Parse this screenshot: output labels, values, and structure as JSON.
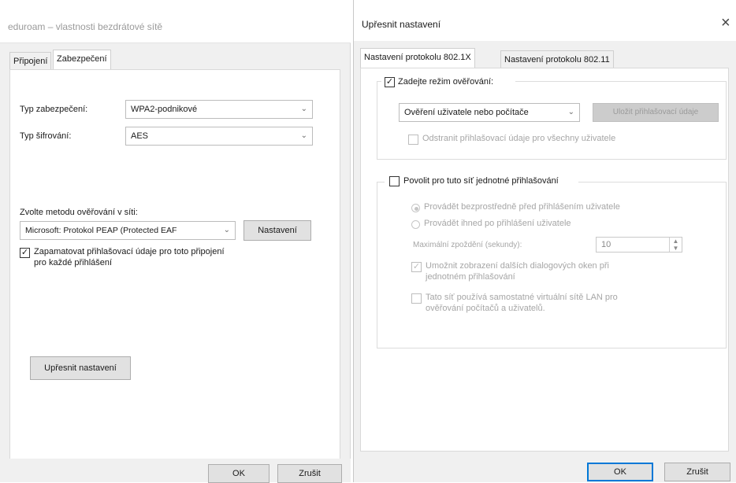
{
  "left_window": {
    "title": "eduroam – vlastnosti bezdrátové sítě",
    "tabs": [
      "Připojení",
      "Zabezpečení"
    ],
    "security_type_label": "Typ zabezpečení:",
    "security_type_value": "WPA2-podnikové",
    "encryption_type_label": "Typ šifrování:",
    "encryption_type_value": "AES",
    "auth_method_label": "Zvolte metodu ověřování v síti:",
    "auth_method_value": "Microsoft: Protokol PEAP (Protected EAF",
    "settings_button": "Nastavení",
    "remember_checkbox_line1": "Zapamatovat přihlašovací údaje pro toto připojení",
    "remember_checkbox_line2": "pro každé přihlášení",
    "remember_checked": true,
    "advanced_button": "Upřesnit nastavení",
    "ok_button": "OK",
    "cancel_button": "Zrušit"
  },
  "right_window": {
    "title": "Upřesnit nastavení",
    "close_glyph": "×",
    "tabs": [
      "Nastavení protokolu 802.1X",
      "Nastavení protokolu 802.11"
    ],
    "specify_auth_label": "Zadejte režim ověřování:",
    "specify_auth_checked": true,
    "auth_mode_value": "Ověření uživatele nebo počítače",
    "save_credentials_button": "Uložit přihlašovací údaje",
    "delete_credentials_label": "Odstranit přihlašovací údaje pro všechny uživatele",
    "sso_label": "Povolit pro tuto síť jednotné přihlašování",
    "sso_checked": false,
    "radio_before_logon": "Provádět bezprostředně před přihlášením uživatele",
    "radio_after_logon": "Provádět ihned po přihlášení uživatele",
    "max_delay_label": "Maximální zpoždění (sekundy):",
    "max_delay_value": "10",
    "allow_dialogs_line1": "Umožnit zobrazení dalších dialogových oken při",
    "allow_dialogs_line2": "jednotném přihlašování",
    "vlan_line1": "Tato síť používá samostatné virtuální sítě LAN pro",
    "vlan_line2": "ověřování počítačů a uživatelů.",
    "ok_button": "OK",
    "cancel_button": "Zrušit"
  }
}
